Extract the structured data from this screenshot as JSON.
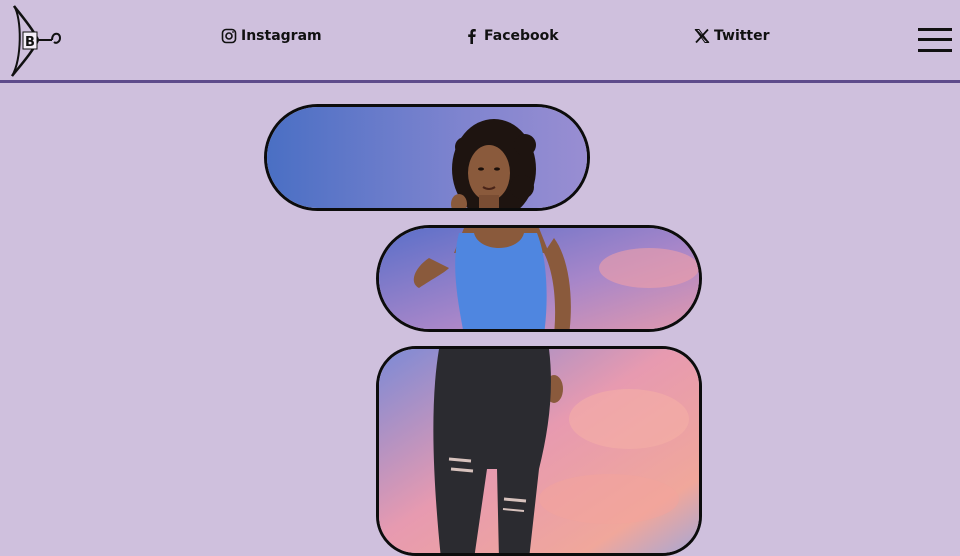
{
  "header": {
    "logo": {
      "letter": "B",
      "icon": "hanger-logo-icon"
    },
    "social_links": [
      {
        "label": "Instagram",
        "icon": "instagram-icon"
      },
      {
        "label": "Facebook",
        "icon": "facebook-icon"
      },
      {
        "label": "Twitter",
        "icon": "x-twitter-icon"
      }
    ],
    "menu": {
      "icon": "hamburger-menu-icon"
    }
  },
  "hero": {
    "panels": [
      {
        "content": "model-head-shoulders"
      },
      {
        "content": "model-blue-tank-top"
      },
      {
        "content": "model-black-ripped-jeans"
      }
    ]
  },
  "colors": {
    "background": "#cfc0dd",
    "header_border": "#5e4b8b",
    "panel_border": "#0c0c0c",
    "tank_top": "#4f86e0",
    "jeans": "#2b2b30",
    "skin": "#8a5a3c",
    "hair": "#1e1410"
  }
}
